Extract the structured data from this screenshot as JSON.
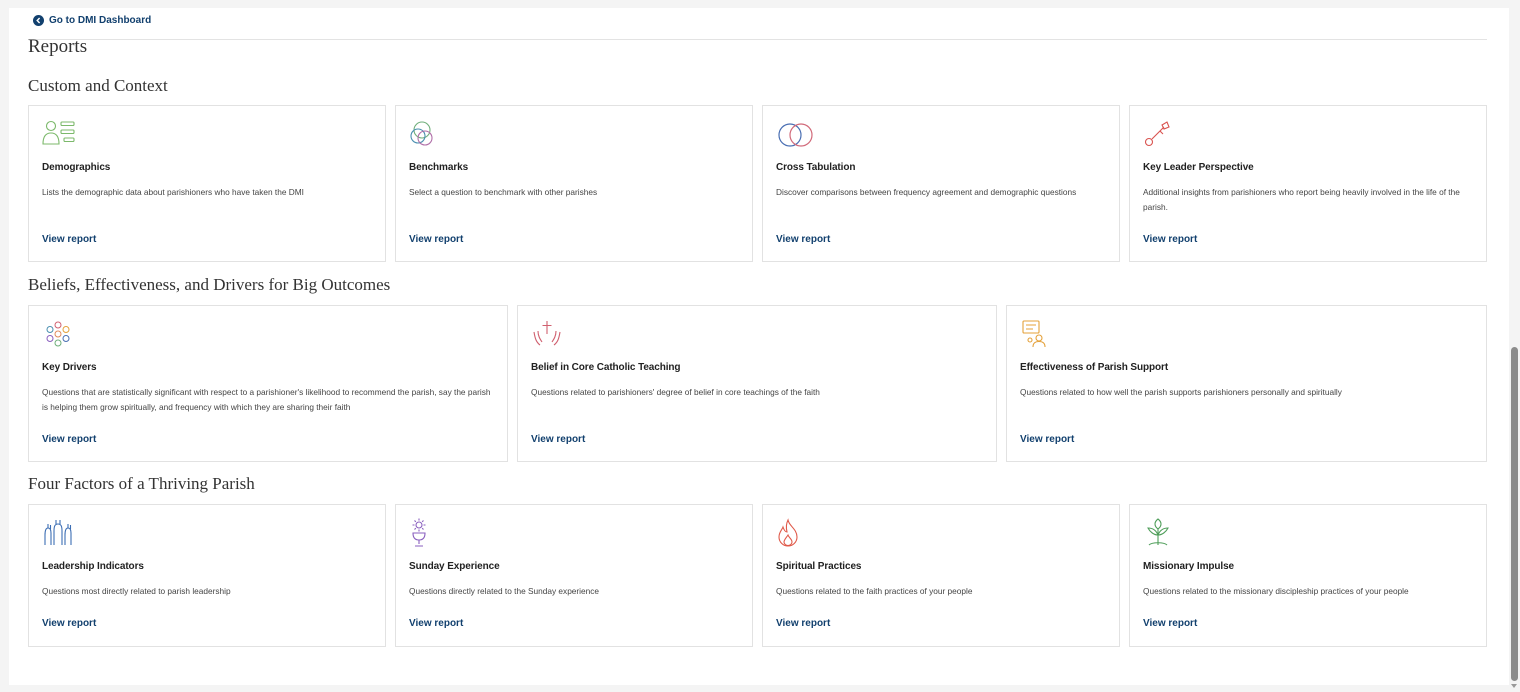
{
  "nav": {
    "back_label": "Go to DMI Dashboard"
  },
  "page_title": "Reports",
  "sections": [
    {
      "title": "Custom and Context",
      "cards": [
        {
          "icon": "demographics-icon",
          "title": "Demographics",
          "description": "Lists the demographic data about parishioners who have taken the DMI",
          "link": "View report"
        },
        {
          "icon": "benchmarks-icon",
          "title": "Benchmarks",
          "description": "Select a question to benchmark with other parishes",
          "link": "View report"
        },
        {
          "icon": "cross-tabulation-icon",
          "title": "Cross Tabulation",
          "description": "Discover comparisons between frequency agreement and demographic questions",
          "link": "View report"
        },
        {
          "icon": "key-icon",
          "title": "Key Leader Perspective",
          "description": "Additional insights from parishioners who report being heavily involved in the life of the parish.",
          "link": "View report"
        }
      ]
    },
    {
      "title": "Beliefs, Effectiveness, and Drivers for Big Outcomes",
      "cards": [
        {
          "icon": "key-drivers-icon",
          "title": "Key Drivers",
          "description": "Questions that are statistically significant with respect to a parishioner's likelihood to recommend the parish, say the parish is helping them grow spiritually, and frequency with which they are sharing their faith",
          "link": "View report"
        },
        {
          "icon": "cross-hands-icon",
          "title": "Belief in Core Catholic Teaching",
          "description": "Questions related to parishioners' degree of belief in core teachings of the faith",
          "link": "View report"
        },
        {
          "icon": "parish-support-icon",
          "title": "Effectiveness of Parish Support",
          "description": "Questions related to how well the parish supports parishioners personally and spiritually",
          "link": "View report"
        }
      ]
    },
    {
      "title": "Four Factors of a Thriving Parish",
      "cards": [
        {
          "icon": "raised-hands-icon",
          "title": "Leadership Indicators",
          "description": "Questions most directly related to parish leadership",
          "link": "View report"
        },
        {
          "icon": "chalice-icon",
          "title": "Sunday Experience",
          "description": "Questions directly related to the Sunday experience",
          "link": "View report"
        },
        {
          "icon": "flame-icon",
          "title": "Spiritual Practices",
          "description": "Questions related to the faith practices of your people",
          "link": "View report"
        },
        {
          "icon": "sprout-icon",
          "title": "Missionary Impulse",
          "description": "Questions related to the missionary discipleship practices of your people",
          "link": "View report"
        }
      ]
    }
  ],
  "colors": {
    "link": "#12406e",
    "demographics": "#7cb96b",
    "benchmarks": "#6fae7a",
    "cross_tab_blue": "#4a6fb3",
    "cross_tab_red": "#d16a7a",
    "key": "#d9534f",
    "drivers": "#e08a5b",
    "cross": "#d0606f",
    "support": "#e4a13a",
    "hands": "#3c6eb4",
    "chalice": "#8a5fbf",
    "flame": "#e05a4a",
    "sprout": "#4f9e5a"
  }
}
